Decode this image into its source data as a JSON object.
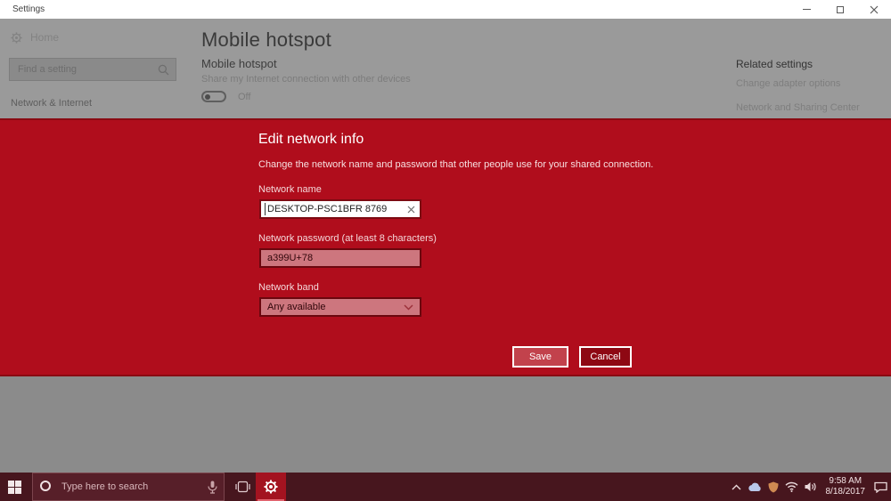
{
  "titlebar": {
    "title": "Settings"
  },
  "sidebar": {
    "home_label": "Home",
    "search_placeholder": "Find a setting",
    "section_label": "Network & Internet"
  },
  "main": {
    "page_title": "Mobile hotspot",
    "section_title": "Mobile hotspot",
    "section_desc": "Share my Internet connection with other devices",
    "toggle_state": "Off"
  },
  "related": {
    "heading": "Related settings",
    "links": [
      "Change adapter options",
      "Network and Sharing Center"
    ]
  },
  "dialog": {
    "title": "Edit network info",
    "description": "Change the network name and password that other people use for your shared connection.",
    "network_name": {
      "label": "Network name",
      "value": "DESKTOP-PSC1BFR 8769"
    },
    "network_password": {
      "label": "Network password (at least 8 characters)",
      "value": "a399U+78"
    },
    "network_band": {
      "label": "Network band",
      "value": "Any available"
    },
    "save_label": "Save",
    "cancel_label": "Cancel"
  },
  "taskbar": {
    "search_placeholder": "Type here to search",
    "clock": {
      "time": "9:58 AM",
      "date": "8/18/2017"
    }
  },
  "colors": {
    "dialog_red": "#b00d1c",
    "dialog_border": "#8a0a12",
    "dimmed_gray": "#9a9a9a",
    "taskbar": "#47161e",
    "settings_tile_active": "#a31320",
    "field_pink": "#cd767e",
    "save_button": "#c2424c",
    "cancel_button": "#8e0813"
  }
}
